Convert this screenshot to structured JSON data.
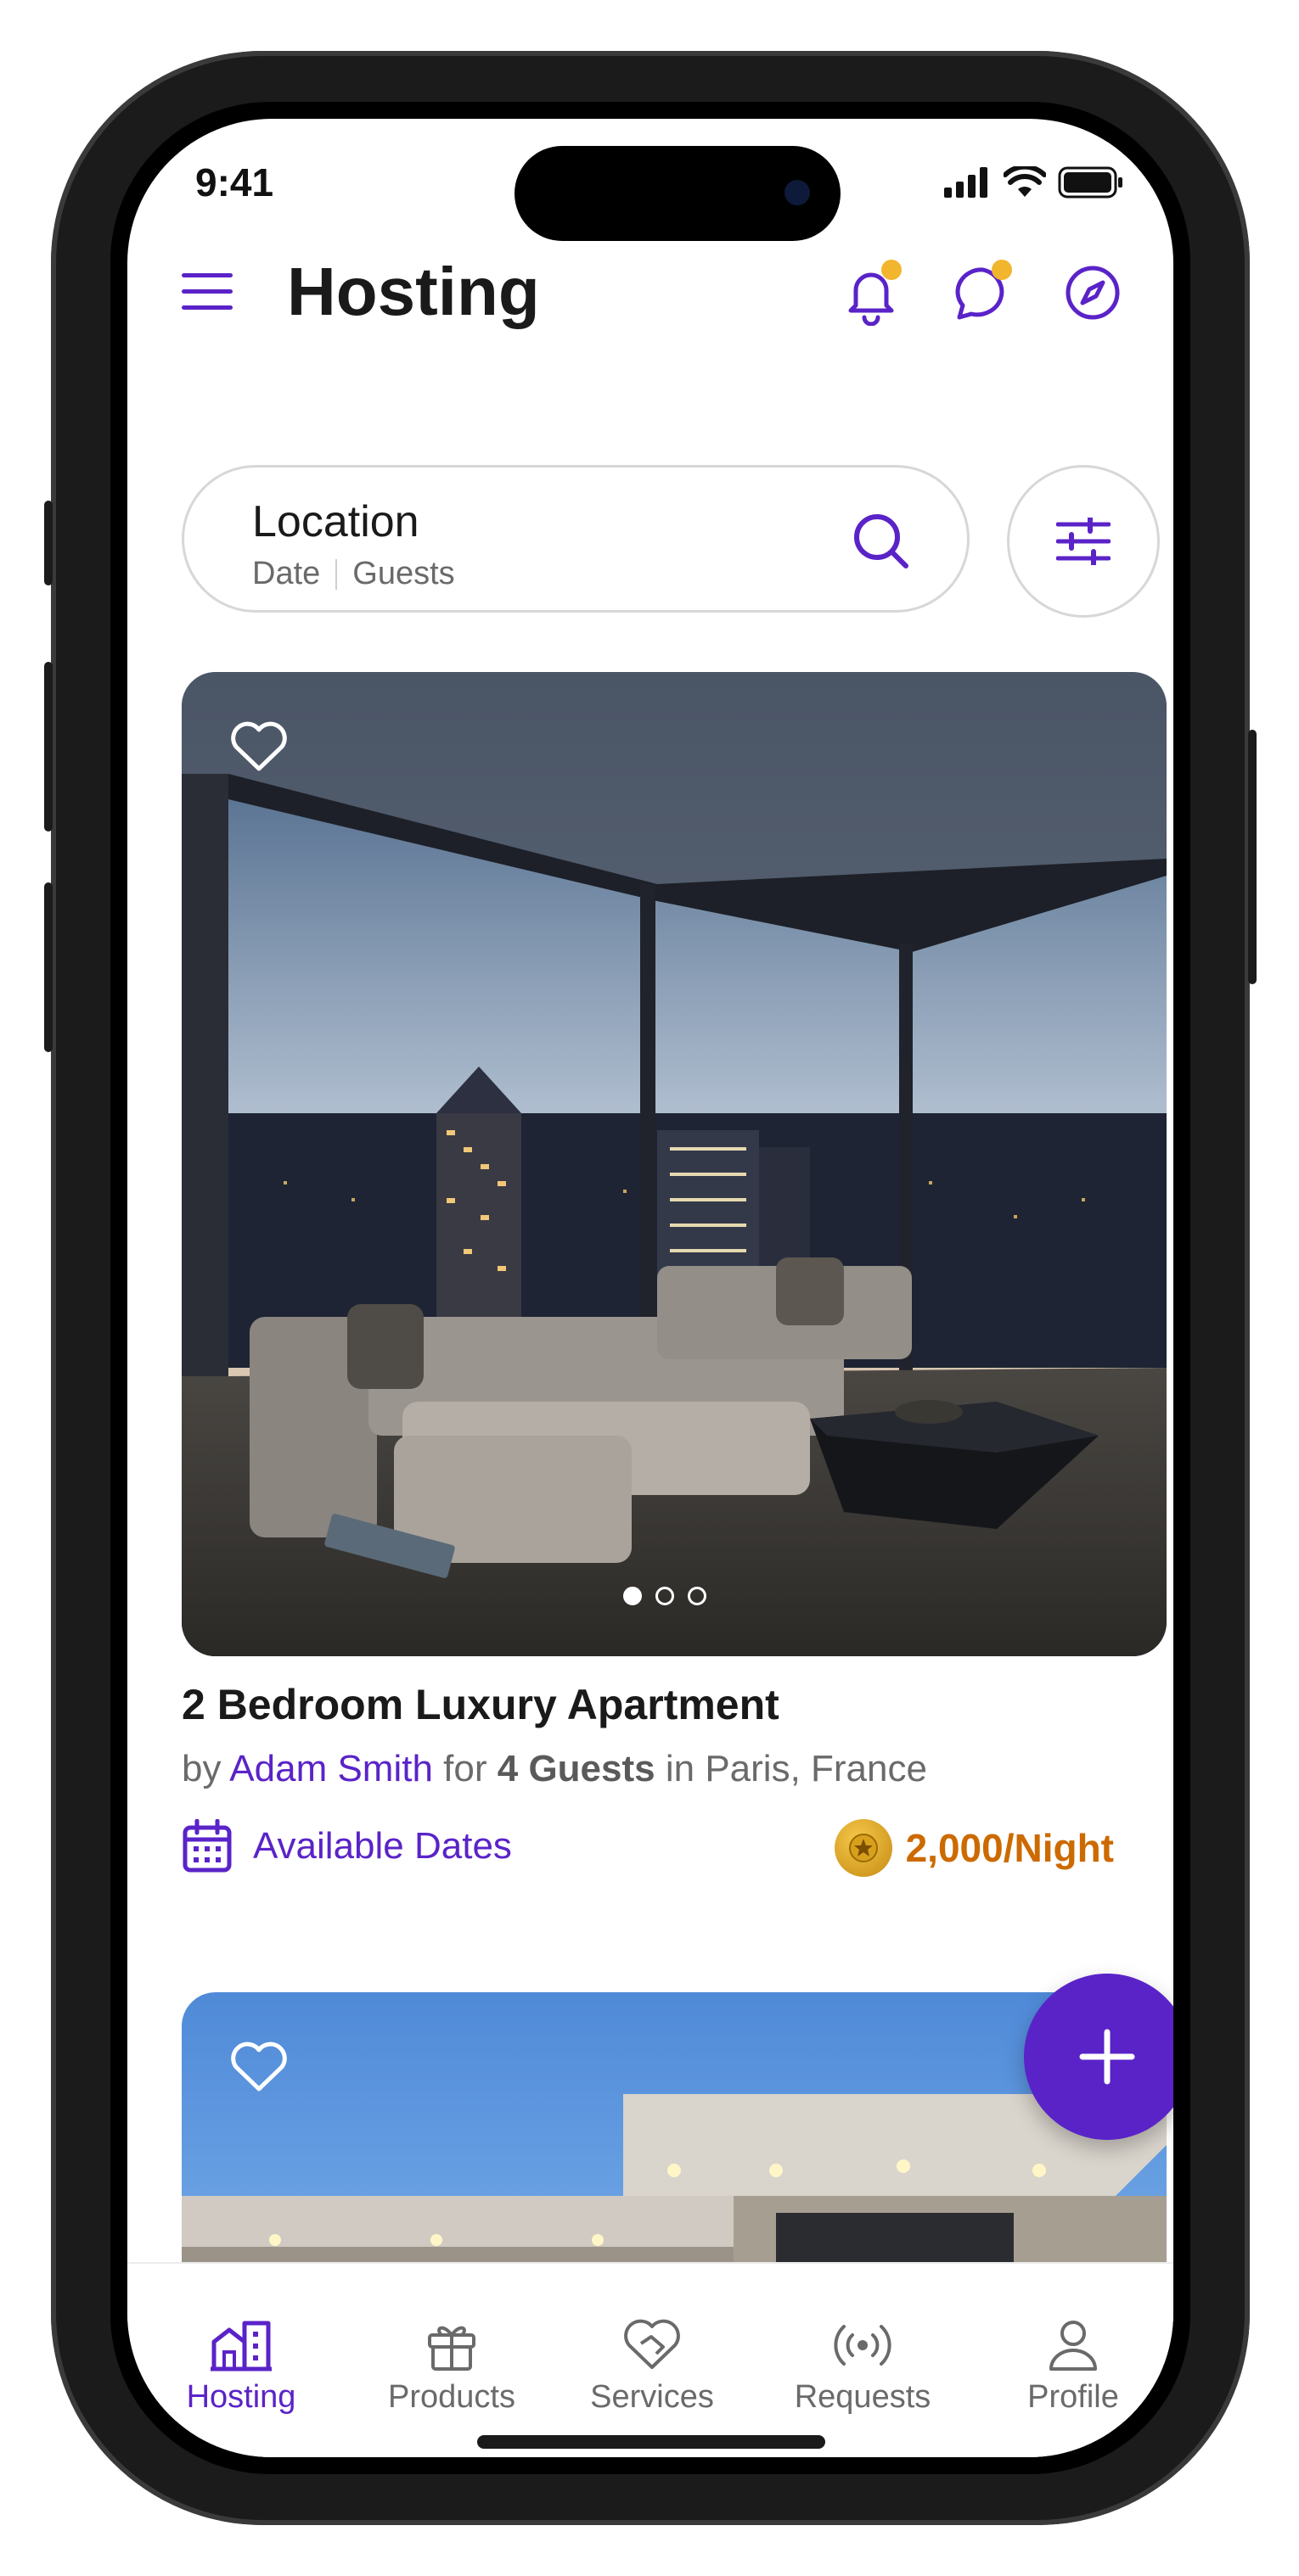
{
  "status": {
    "time": "9:41"
  },
  "header": {
    "title": "Hosting"
  },
  "search": {
    "location": "Location",
    "date": "Date",
    "guests": "Guests"
  },
  "listing": {
    "title": "2 Bedroom Luxury Apartment",
    "by": "by",
    "host": "Adam Smith",
    "for": "for",
    "guests": "4 Guests",
    "in_location": "in Paris, France",
    "available_dates_label": "Available Dates",
    "price": "2,000/Night",
    "carousel_index": 1,
    "carousel_count": 3
  },
  "tabs": [
    {
      "label": "Hosting",
      "active": true
    },
    {
      "label": "Products",
      "active": false
    },
    {
      "label": "Services",
      "active": false
    },
    {
      "label": "Requests",
      "active": false
    },
    {
      "label": "Profile",
      "active": false
    }
  ],
  "colors": {
    "accent": "#5a23c8",
    "notification_dot": "#f2b52e",
    "price": "#cc6a00"
  }
}
